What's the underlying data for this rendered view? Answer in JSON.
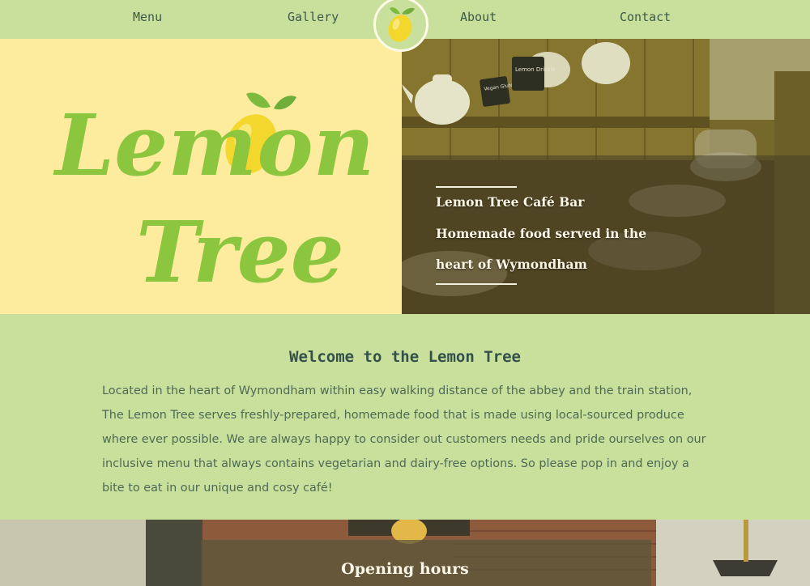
{
  "nav": {
    "items": [
      {
        "label": "Menu"
      },
      {
        "label": "Gallery"
      },
      {
        "label": "About"
      },
      {
        "label": "Contact"
      }
    ]
  },
  "logo": {
    "line1": "Lemon",
    "line2": "Tree"
  },
  "hero": {
    "caption_title": "Lemon Tree Café Bar",
    "caption_line1": "Homemade food served in the",
    "caption_line2": "heart of Wymondham",
    "photo_labels": [
      "Vegan Gluten Free",
      "Lemon Drizzle"
    ]
  },
  "welcome": {
    "title": "Welcome to the Lemon Tree",
    "body": "Located in the heart of Wymondham within easy walking distance of the abbey and the train station, The Lemon Tree serves freshly-prepared, homemade food that is made using local-sourced produce where ever possible. We are always happy to consider out customers needs and pride ourselves on our inclusive menu that always contains vegetarian and dairy-free options. So please pop in and enjoy a bite to eat in our unique and cosy café!"
  },
  "hours": {
    "title": "Opening hours"
  },
  "colors": {
    "nav_bg": "#c9e09c",
    "logo_bg": "#fdec9e",
    "logo_green": "#8cc63f",
    "lemon_yellow": "#f3d72d",
    "heading_text": "#33504a",
    "body_text": "#4d6a55"
  }
}
